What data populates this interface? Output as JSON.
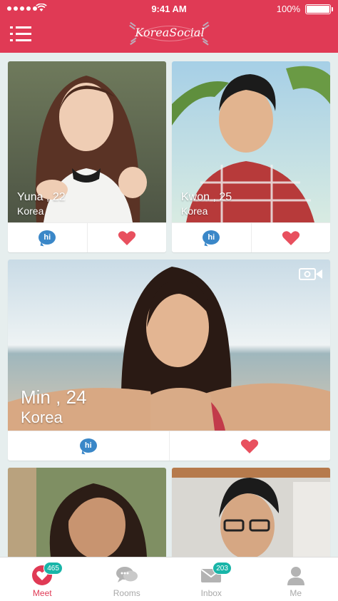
{
  "status_bar": {
    "time": "9:41 AM",
    "battery": "100%"
  },
  "header": {
    "logo_text": "KoreaSocial"
  },
  "profiles": [
    {
      "name": "Yuna , 22",
      "country": "Korea",
      "hi_label": "hi"
    },
    {
      "name": "Kwon , 25",
      "country": "Korea",
      "hi_label": "hi"
    },
    {
      "name": "Min , 24",
      "country": "Korea",
      "hi_label": "hi"
    },
    {
      "name": "",
      "country": "",
      "hi_label": ""
    },
    {
      "name": "",
      "country": "",
      "hi_label": ""
    }
  ],
  "tabs": [
    {
      "label": "Meet",
      "badge": "465",
      "icon": "heart-icon",
      "active": true
    },
    {
      "label": "Rooms",
      "badge": "",
      "icon": "chat-bubbles-icon",
      "active": false
    },
    {
      "label": "Inbox",
      "badge": "203",
      "icon": "envelope-icon",
      "active": false
    },
    {
      "label": "Me",
      "badge": "",
      "icon": "person-icon",
      "active": false
    }
  ],
  "colors": {
    "brand": "#e03a55",
    "hi_bubble": "#3a87c8",
    "heart": "#e8505e",
    "badge": "#19b5a8"
  }
}
